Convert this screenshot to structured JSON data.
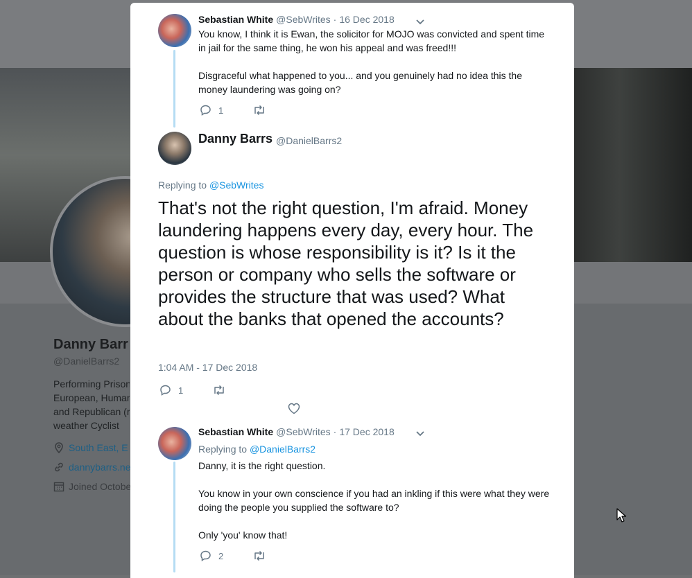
{
  "background": {
    "profile_name": "Danny Barr",
    "profile_handle": "@DanielBarrs2",
    "bio_lines": [
      "Performing Prison",
      "European, Human",
      "and Republican (r",
      "weather Cyclist"
    ],
    "location": "South East, E",
    "website": "dannybarrs.ne",
    "joined": "Joined Octobe"
  },
  "thread": {
    "parent_tweet": {
      "name": "Sebastian White",
      "screen_name": "@SebWrites",
      "separator": "·",
      "date": "16 Dec 2018",
      "paragraphs": [
        "You know, I think it is Ewan, the solicitor for MOJO was convicted and spent time in jail for the same thing, he won his appeal and was freed!!!",
        "Disgraceful what happened to you... and you genuinely had no idea this the money laundering was going on?"
      ],
      "reply_count": "1"
    },
    "main_tweet": {
      "name": "Danny Barrs",
      "screen_name": "@DanielBarrs2",
      "replying_label": "Replying to",
      "replying_to": "@SebWrites",
      "text": "That's not the right question, I'm afraid.  Money laundering happens every day, every hour. The question is whose responsibility is it?  Is it the person or company who sells the software or provides the structure that was used? What about the banks that opened the accounts?",
      "timestamp": "1:04 AM - 17 Dec 2018",
      "reply_count": "1"
    },
    "reply_tweet": {
      "name": "Sebastian White",
      "screen_name": "@SebWrites",
      "separator": "·",
      "date": "17 Dec 2018",
      "replying_label": "Replying to",
      "replying_to": "@DanielBarrs2",
      "paragraphs": [
        "Danny, it is the right question.",
        "You know in your own conscience if you had an inkling if this were what they were doing the people you supplied the software to?",
        "Only 'you' know that!"
      ],
      "reply_count": "2"
    }
  },
  "colors": {
    "link": "#1b95e0",
    "thread_line": "#b5dcf3",
    "secondary_text": "#657786"
  }
}
